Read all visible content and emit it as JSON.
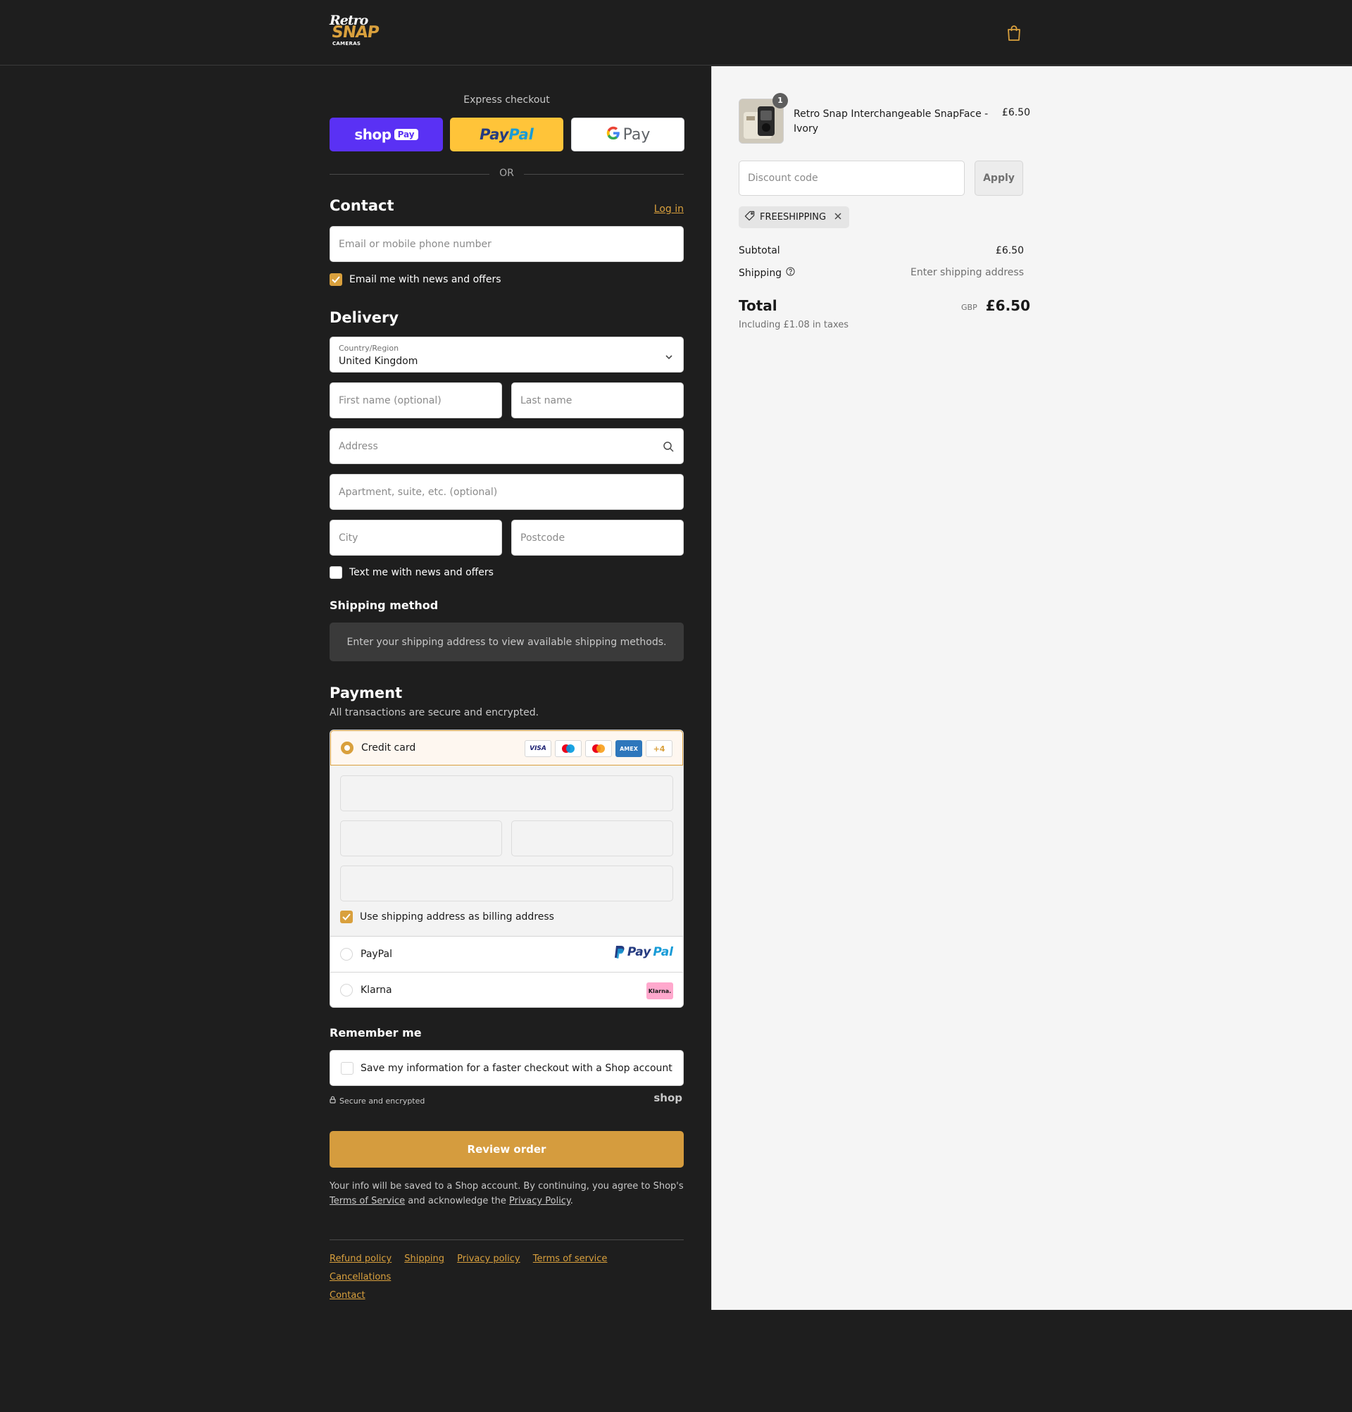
{
  "header": {
    "logo_text": {
      "line1": "Retro",
      "line2": "SNAP",
      "line3": "CAMERAS"
    },
    "cart_icon": "shopping-bag-icon"
  },
  "express": {
    "title": "Express checkout",
    "shop_pay": {
      "word": "shop",
      "pill": "Pay"
    },
    "paypal": {
      "pay": "Pay",
      "pal": "Pal"
    },
    "gpay": {
      "g": "G",
      "pay": "Pay"
    },
    "or_text": "OR"
  },
  "contact": {
    "title": "Contact",
    "login_label": "Log in",
    "email_placeholder": "Email or mobile phone number",
    "newsletter_label": "Email me with news and offers",
    "newsletter_checked": true
  },
  "delivery": {
    "title": "Delivery",
    "country_label": "Country/Region",
    "country_value": "United Kingdom",
    "first_name_placeholder": "First name (optional)",
    "last_name_placeholder": "Last name",
    "address_placeholder": "Address",
    "apartment_placeholder": "Apartment, suite, etc. (optional)",
    "city_placeholder": "City",
    "postcode_placeholder": "Postcode",
    "sms_label": "Text me with news and offers",
    "sms_checked": false
  },
  "shipping_method": {
    "title": "Shipping method",
    "message": "Enter your shipping address to view available shipping methods."
  },
  "payment": {
    "title": "Payment",
    "note": "All transactions are secure and encrypted.",
    "credit_card_label": "Credit card",
    "card_brands": [
      "VISA",
      "Maestro",
      "Mastercard",
      "AMEX",
      "+4"
    ],
    "billing_label": "Use shipping address as billing address",
    "billing_checked": true,
    "paypal_label": "PayPal",
    "klarna_label": "Klarna",
    "klarna_badge": "Klarna."
  },
  "remember": {
    "title": "Remember me",
    "save_label": "Save my information for a faster checkout with a Shop account",
    "secure_label": "Secure and encrypted",
    "shop_mark": "shop"
  },
  "review_button": "Review order",
  "legal": {
    "text_before": "Your info will be saved to a Shop account. By continuing, you agree to Shop's",
    "terms_link": "Terms of Service",
    "text_middle": "and acknowledge the",
    "privacy_link": "Privacy Policy",
    "text_after": "."
  },
  "footer_links": [
    "Refund policy",
    "Shipping",
    "Privacy policy",
    "Terms of service",
    "Cancellations",
    "Contact"
  ],
  "summary": {
    "item": {
      "name": "Retro Snap Interchangeable SnapFace - Ivory",
      "quantity": "1",
      "price": "£6.50"
    },
    "discount_placeholder": "Discount code",
    "apply_label": "Apply",
    "applied_code": "FREESHIPPING",
    "subtotal_label": "Subtotal",
    "subtotal_value": "£6.50",
    "shipping_label": "Shipping",
    "shipping_value": "Enter shipping address",
    "total_label": "Total",
    "total_currency": "GBP",
    "total_value": "£6.50",
    "tax_note": "Including £1.08 in taxes"
  },
  "colors": {
    "accent": "#d9a03d",
    "page_bg": "#1e1e1e",
    "summary_bg": "#f5f5f5",
    "shop_pay": "#5a31f4",
    "paypal_button": "#ffc439"
  }
}
